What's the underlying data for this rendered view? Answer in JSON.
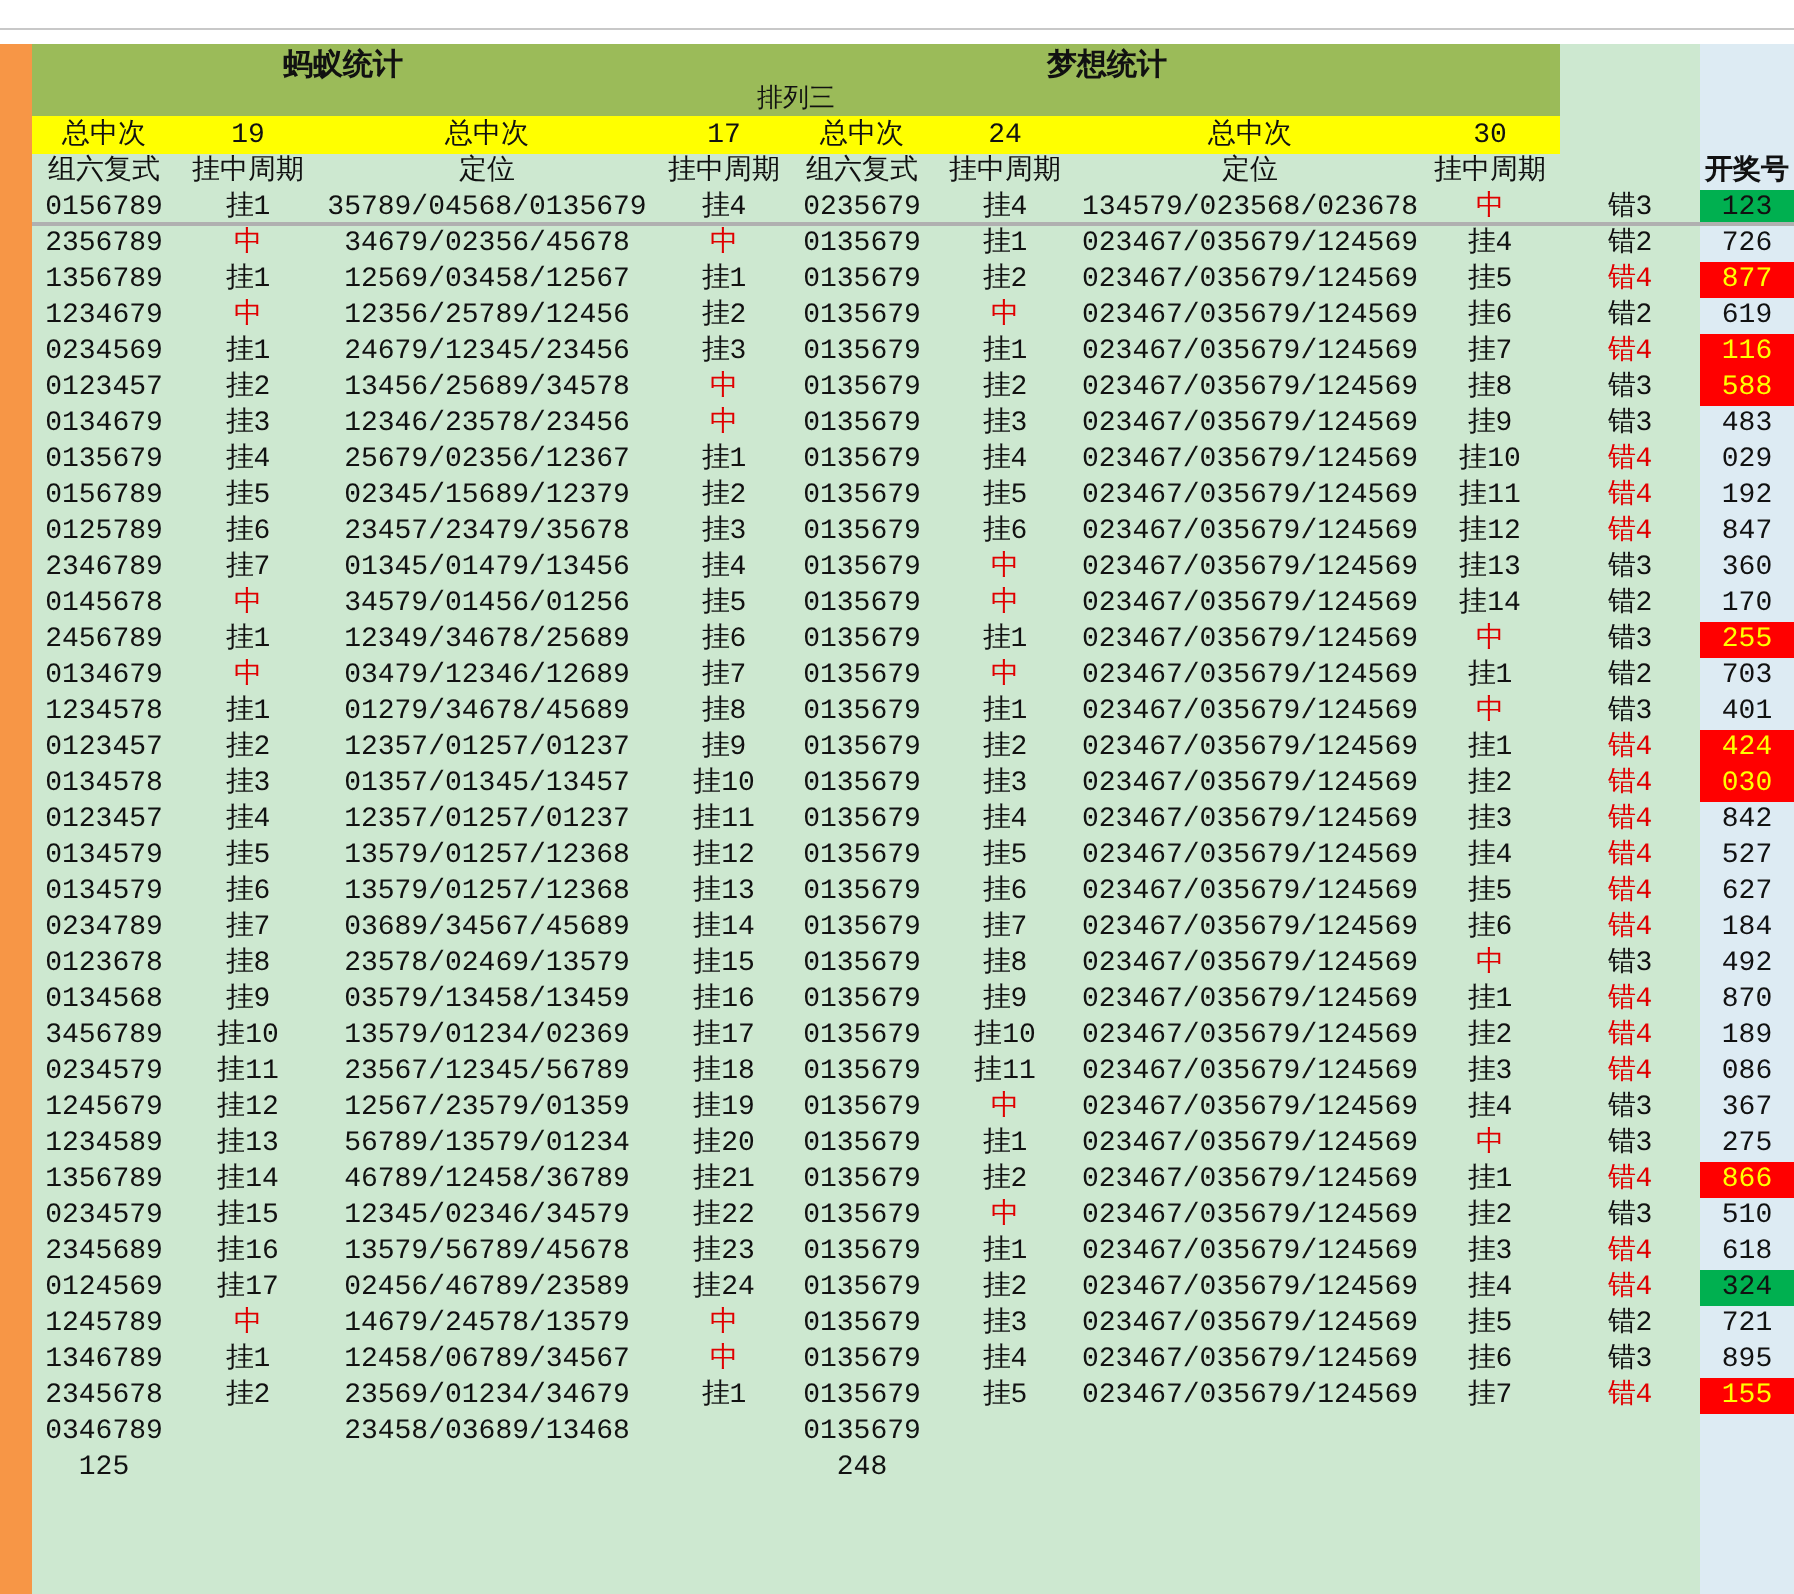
{
  "title": "排列三",
  "sections": [
    {
      "title": "蚂蚁统计"
    },
    {
      "title": "梦想统计"
    }
  ],
  "summary": [
    {
      "label": "总中次",
      "value": "19"
    },
    {
      "label": "总中次",
      "value": "17"
    },
    {
      "label": "总中次",
      "value": "24"
    },
    {
      "label": "总中次",
      "value": "30"
    }
  ],
  "columns": [
    "组六复式",
    "挂中周期",
    "定位",
    "挂中周期",
    "组六复式",
    "挂中周期",
    "定位",
    "挂中周期"
  ],
  "draw_column": "开奖号",
  "rows": [
    {
      "combo1": "0156789",
      "cycle1": "挂1",
      "cycle1_hit": false,
      "pos1": "35789/04568/0135679",
      "pos_cycle1": "挂4",
      "pos_cycle1_hit": false,
      "combo2": "0235679",
      "cycle2": "挂4",
      "cycle2_hit": false,
      "pos2": "134579/023568/023678",
      "pos_cycle2": "中",
      "pos_cycle2_hit": true,
      "miss": "错3",
      "miss_high": false,
      "draw": {
        "number": "123",
        "color": "#00b050"
      }
    },
    {
      "combo1": "2356789",
      "cycle1": "中",
      "cycle1_hit": true,
      "pos1": "34679/02356/45678",
      "pos_cycle1": "中",
      "pos_cycle1_hit": true,
      "combo2": "0135679",
      "cycle2": "挂1",
      "cycle2_hit": false,
      "pos2": "023467/035679/124569",
      "pos_cycle2": "挂4",
      "pos_cycle2_hit": false,
      "miss": "错2",
      "miss_high": false,
      "draw": {
        "number": "726"
      }
    },
    {
      "combo1": "1356789",
      "cycle1": "挂1",
      "cycle1_hit": false,
      "pos1": "12569/03458/12567",
      "pos_cycle1": "挂1",
      "pos_cycle1_hit": false,
      "combo2": "0135679",
      "cycle2": "挂2",
      "cycle2_hit": false,
      "pos2": "023467/035679/124569",
      "pos_cycle2": "挂5",
      "pos_cycle2_hit": false,
      "miss": "错4",
      "miss_high": true,
      "draw": {
        "number": "877",
        "color": "#ff0000"
      }
    },
    {
      "combo1": "1234679",
      "cycle1": "中",
      "cycle1_hit": true,
      "pos1": "12356/25789/12456",
      "pos_cycle1": "挂2",
      "pos_cycle1_hit": false,
      "combo2": "0135679",
      "cycle2": "中",
      "cycle2_hit": true,
      "pos2": "023467/035679/124569",
      "pos_cycle2": "挂6",
      "pos_cycle2_hit": false,
      "miss": "错2",
      "miss_high": false,
      "draw": {
        "number": "619"
      }
    },
    {
      "combo1": "0234569",
      "cycle1": "挂1",
      "cycle1_hit": false,
      "pos1": "24679/12345/23456",
      "pos_cycle1": "挂3",
      "pos_cycle1_hit": false,
      "combo2": "0135679",
      "cycle2": "挂1",
      "cycle2_hit": false,
      "pos2": "023467/035679/124569",
      "pos_cycle2": "挂7",
      "pos_cycle2_hit": false,
      "miss": "错4",
      "miss_high": true,
      "draw": {
        "number": "116",
        "color": "#ff0000"
      }
    },
    {
      "combo1": "0123457",
      "cycle1": "挂2",
      "cycle1_hit": false,
      "pos1": "13456/25689/34578",
      "pos_cycle1": "中",
      "pos_cycle1_hit": true,
      "combo2": "0135679",
      "cycle2": "挂2",
      "cycle2_hit": false,
      "pos2": "023467/035679/124569",
      "pos_cycle2": "挂8",
      "pos_cycle2_hit": false,
      "miss": "错3",
      "miss_high": false,
      "draw": {
        "number": "588",
        "color": "#ff0000"
      }
    },
    {
      "combo1": "0134679",
      "cycle1": "挂3",
      "cycle1_hit": false,
      "pos1": "12346/23578/23456",
      "pos_cycle1": "中",
      "pos_cycle1_hit": true,
      "combo2": "0135679",
      "cycle2": "挂3",
      "cycle2_hit": false,
      "pos2": "023467/035679/124569",
      "pos_cycle2": "挂9",
      "pos_cycle2_hit": false,
      "miss": "错3",
      "miss_high": false,
      "draw": {
        "number": "483"
      }
    },
    {
      "combo1": "0135679",
      "cycle1": "挂4",
      "cycle1_hit": false,
      "pos1": "25679/02356/12367",
      "pos_cycle1": "挂1",
      "pos_cycle1_hit": false,
      "combo2": "0135679",
      "cycle2": "挂4",
      "cycle2_hit": false,
      "pos2": "023467/035679/124569",
      "pos_cycle2": "挂10",
      "pos_cycle2_hit": false,
      "miss": "错4",
      "miss_high": true,
      "draw": {
        "number": "029"
      }
    },
    {
      "combo1": "0156789",
      "cycle1": "挂5",
      "cycle1_hit": false,
      "pos1": "02345/15689/12379",
      "pos_cycle1": "挂2",
      "pos_cycle1_hit": false,
      "combo2": "0135679",
      "cycle2": "挂5",
      "cycle2_hit": false,
      "pos2": "023467/035679/124569",
      "pos_cycle2": "挂11",
      "pos_cycle2_hit": false,
      "miss": "错4",
      "miss_high": true,
      "draw": {
        "number": "192"
      }
    },
    {
      "combo1": "0125789",
      "cycle1": "挂6",
      "cycle1_hit": false,
      "pos1": "23457/23479/35678",
      "pos_cycle1": "挂3",
      "pos_cycle1_hit": false,
      "combo2": "0135679",
      "cycle2": "挂6",
      "cycle2_hit": false,
      "pos2": "023467/035679/124569",
      "pos_cycle2": "挂12",
      "pos_cycle2_hit": false,
      "miss": "错4",
      "miss_high": true,
      "draw": {
        "number": "847"
      }
    },
    {
      "combo1": "2346789",
      "cycle1": "挂7",
      "cycle1_hit": false,
      "pos1": "01345/01479/13456",
      "pos_cycle1": "挂4",
      "pos_cycle1_hit": false,
      "combo2": "0135679",
      "cycle2": "中",
      "cycle2_hit": true,
      "pos2": "023467/035679/124569",
      "pos_cycle2": "挂13",
      "pos_cycle2_hit": false,
      "miss": "错3",
      "miss_high": false,
      "draw": {
        "number": "360"
      }
    },
    {
      "combo1": "0145678",
      "cycle1": "中",
      "cycle1_hit": true,
      "pos1": "34579/01456/01256",
      "pos_cycle1": "挂5",
      "pos_cycle1_hit": false,
      "combo2": "0135679",
      "cycle2": "中",
      "cycle2_hit": true,
      "pos2": "023467/035679/124569",
      "pos_cycle2": "挂14",
      "pos_cycle2_hit": false,
      "miss": "错2",
      "miss_high": false,
      "draw": {
        "number": "170"
      }
    },
    {
      "combo1": "2456789",
      "cycle1": "挂1",
      "cycle1_hit": false,
      "pos1": "12349/34678/25689",
      "pos_cycle1": "挂6",
      "pos_cycle1_hit": false,
      "combo2": "0135679",
      "cycle2": "挂1",
      "cycle2_hit": false,
      "pos2": "023467/035679/124569",
      "pos_cycle2": "中",
      "pos_cycle2_hit": true,
      "miss": "错3",
      "miss_high": false,
      "draw": {
        "number": "255",
        "color": "#ff0000"
      }
    },
    {
      "combo1": "0134679",
      "cycle1": "中",
      "cycle1_hit": true,
      "pos1": "03479/12346/12689",
      "pos_cycle1": "挂7",
      "pos_cycle1_hit": false,
      "combo2": "0135679",
      "cycle2": "中",
      "cycle2_hit": true,
      "pos2": "023467/035679/124569",
      "pos_cycle2": "挂1",
      "pos_cycle2_hit": false,
      "miss": "错2",
      "miss_high": false,
      "draw": {
        "number": "703"
      }
    },
    {
      "combo1": "1234578",
      "cycle1": "挂1",
      "cycle1_hit": false,
      "pos1": "01279/34678/45689",
      "pos_cycle1": "挂8",
      "pos_cycle1_hit": false,
      "combo2": "0135679",
      "cycle2": "挂1",
      "cycle2_hit": false,
      "pos2": "023467/035679/124569",
      "pos_cycle2": "中",
      "pos_cycle2_hit": true,
      "miss": "错3",
      "miss_high": false,
      "draw": {
        "number": "401"
      }
    },
    {
      "combo1": "0123457",
      "cycle1": "挂2",
      "cycle1_hit": false,
      "pos1": "12357/01257/01237",
      "pos_cycle1": "挂9",
      "pos_cycle1_hit": false,
      "combo2": "0135679",
      "cycle2": "挂2",
      "cycle2_hit": false,
      "pos2": "023467/035679/124569",
      "pos_cycle2": "挂1",
      "pos_cycle2_hit": false,
      "miss": "错4",
      "miss_high": true,
      "draw": {
        "number": "424",
        "color": "#ff0000"
      }
    },
    {
      "combo1": "0134578",
      "cycle1": "挂3",
      "cycle1_hit": false,
      "pos1": "01357/01345/13457",
      "pos_cycle1": "挂10",
      "pos_cycle1_hit": false,
      "combo2": "0135679",
      "cycle2": "挂3",
      "cycle2_hit": false,
      "pos2": "023467/035679/124569",
      "pos_cycle2": "挂2",
      "pos_cycle2_hit": false,
      "miss": "错4",
      "miss_high": true,
      "draw": {
        "number": "030",
        "color": "#ff0000"
      }
    },
    {
      "combo1": "0123457",
      "cycle1": "挂4",
      "cycle1_hit": false,
      "pos1": "12357/01257/01237",
      "pos_cycle1": "挂11",
      "pos_cycle1_hit": false,
      "combo2": "0135679",
      "cycle2": "挂4",
      "cycle2_hit": false,
      "pos2": "023467/035679/124569",
      "pos_cycle2": "挂3",
      "pos_cycle2_hit": false,
      "miss": "错4",
      "miss_high": true,
      "draw": {
        "number": "842"
      }
    },
    {
      "combo1": "0134579",
      "cycle1": "挂5",
      "cycle1_hit": false,
      "pos1": "13579/01257/12368",
      "pos_cycle1": "挂12",
      "pos_cycle1_hit": false,
      "combo2": "0135679",
      "cycle2": "挂5",
      "cycle2_hit": false,
      "pos2": "023467/035679/124569",
      "pos_cycle2": "挂4",
      "pos_cycle2_hit": false,
      "miss": "错4",
      "miss_high": true,
      "draw": {
        "number": "527"
      }
    },
    {
      "combo1": "0134579",
      "cycle1": "挂6",
      "cycle1_hit": false,
      "pos1": "13579/01257/12368",
      "pos_cycle1": "挂13",
      "pos_cycle1_hit": false,
      "combo2": "0135679",
      "cycle2": "挂6",
      "cycle2_hit": false,
      "pos2": "023467/035679/124569",
      "pos_cycle2": "挂5",
      "pos_cycle2_hit": false,
      "miss": "错4",
      "miss_high": true,
      "draw": {
        "number": "627"
      }
    },
    {
      "combo1": "0234789",
      "cycle1": "挂7",
      "cycle1_hit": false,
      "pos1": "03689/34567/45689",
      "pos_cycle1": "挂14",
      "pos_cycle1_hit": false,
      "combo2": "0135679",
      "cycle2": "挂7",
      "cycle2_hit": false,
      "pos2": "023467/035679/124569",
      "pos_cycle2": "挂6",
      "pos_cycle2_hit": false,
      "miss": "错4",
      "miss_high": true,
      "draw": {
        "number": "184"
      }
    },
    {
      "combo1": "0123678",
      "cycle1": "挂8",
      "cycle1_hit": false,
      "pos1": "23578/02469/13579",
      "pos_cycle1": "挂15",
      "pos_cycle1_hit": false,
      "combo2": "0135679",
      "cycle2": "挂8",
      "cycle2_hit": false,
      "pos2": "023467/035679/124569",
      "pos_cycle2": "中",
      "pos_cycle2_hit": true,
      "miss": "错3",
      "miss_high": false,
      "draw": {
        "number": "492"
      }
    },
    {
      "combo1": "0134568",
      "cycle1": "挂9",
      "cycle1_hit": false,
      "pos1": "03579/13458/13459",
      "pos_cycle1": "挂16",
      "pos_cycle1_hit": false,
      "combo2": "0135679",
      "cycle2": "挂9",
      "cycle2_hit": false,
      "pos2": "023467/035679/124569",
      "pos_cycle2": "挂1",
      "pos_cycle2_hit": false,
      "miss": "错4",
      "miss_high": true,
      "draw": {
        "number": "870"
      }
    },
    {
      "combo1": "3456789",
      "cycle1": "挂10",
      "cycle1_hit": false,
      "pos1": "13579/01234/02369",
      "pos_cycle1": "挂17",
      "pos_cycle1_hit": false,
      "combo2": "0135679",
      "cycle2": "挂10",
      "cycle2_hit": false,
      "pos2": "023467/035679/124569",
      "pos_cycle2": "挂2",
      "pos_cycle2_hit": false,
      "miss": "错4",
      "miss_high": true,
      "draw": {
        "number": "189"
      }
    },
    {
      "combo1": "0234579",
      "cycle1": "挂11",
      "cycle1_hit": false,
      "pos1": "23567/12345/56789",
      "pos_cycle1": "挂18",
      "pos_cycle1_hit": false,
      "combo2": "0135679",
      "cycle2": "挂11",
      "cycle2_hit": false,
      "pos2": "023467/035679/124569",
      "pos_cycle2": "挂3",
      "pos_cycle2_hit": false,
      "miss": "错4",
      "miss_high": true,
      "draw": {
        "number": "086"
      }
    },
    {
      "combo1": "1245679",
      "cycle1": "挂12",
      "cycle1_hit": false,
      "pos1": "12567/23579/01359",
      "pos_cycle1": "挂19",
      "pos_cycle1_hit": false,
      "combo2": "0135679",
      "cycle2": "中",
      "cycle2_hit": true,
      "pos2": "023467/035679/124569",
      "pos_cycle2": "挂4",
      "pos_cycle2_hit": false,
      "miss": "错3",
      "miss_high": false,
      "draw": {
        "number": "367"
      }
    },
    {
      "combo1": "1234589",
      "cycle1": "挂13",
      "cycle1_hit": false,
      "pos1": "56789/13579/01234",
      "pos_cycle1": "挂20",
      "pos_cycle1_hit": false,
      "combo2": "0135679",
      "cycle2": "挂1",
      "cycle2_hit": false,
      "pos2": "023467/035679/124569",
      "pos_cycle2": "中",
      "pos_cycle2_hit": true,
      "miss": "错3",
      "miss_high": false,
      "draw": {
        "number": "275"
      }
    },
    {
      "combo1": "1356789",
      "cycle1": "挂14",
      "cycle1_hit": false,
      "pos1": "46789/12458/36789",
      "pos_cycle1": "挂21",
      "pos_cycle1_hit": false,
      "combo2": "0135679",
      "cycle2": "挂2",
      "cycle2_hit": false,
      "pos2": "023467/035679/124569",
      "pos_cycle2": "挂1",
      "pos_cycle2_hit": false,
      "miss": "错4",
      "miss_high": true,
      "draw": {
        "number": "866",
        "color": "#ff0000"
      }
    },
    {
      "combo1": "0234579",
      "cycle1": "挂15",
      "cycle1_hit": false,
      "pos1": "12345/02346/34579",
      "pos_cycle1": "挂22",
      "pos_cycle1_hit": false,
      "combo2": "0135679",
      "cycle2": "中",
      "cycle2_hit": true,
      "pos2": "023467/035679/124569",
      "pos_cycle2": "挂2",
      "pos_cycle2_hit": false,
      "miss": "错3",
      "miss_high": false,
      "draw": {
        "number": "510"
      }
    },
    {
      "combo1": "2345689",
      "cycle1": "挂16",
      "cycle1_hit": false,
      "pos1": "13579/56789/45678",
      "pos_cycle1": "挂23",
      "pos_cycle1_hit": false,
      "combo2": "0135679",
      "cycle2": "挂1",
      "cycle2_hit": false,
      "pos2": "023467/035679/124569",
      "pos_cycle2": "挂3",
      "pos_cycle2_hit": false,
      "miss": "错4",
      "miss_high": true,
      "draw": {
        "number": "618"
      }
    },
    {
      "combo1": "0124569",
      "cycle1": "挂17",
      "cycle1_hit": false,
      "pos1": "02456/46789/23589",
      "pos_cycle1": "挂24",
      "pos_cycle1_hit": false,
      "combo2": "0135679",
      "cycle2": "挂2",
      "cycle2_hit": false,
      "pos2": "023467/035679/124569",
      "pos_cycle2": "挂4",
      "pos_cycle2_hit": false,
      "miss": "错4",
      "miss_high": true,
      "draw": {
        "number": "324",
        "color": "#00b050"
      }
    },
    {
      "combo1": "1245789",
      "cycle1": "中",
      "cycle1_hit": true,
      "pos1": "14679/24578/13579",
      "pos_cycle1": "中",
      "pos_cycle1_hit": true,
      "combo2": "0135679",
      "cycle2": "挂3",
      "cycle2_hit": false,
      "pos2": "023467/035679/124569",
      "pos_cycle2": "挂5",
      "pos_cycle2_hit": false,
      "miss": "错2",
      "miss_high": false,
      "draw": {
        "number": "721"
      }
    },
    {
      "combo1": "1346789",
      "cycle1": "挂1",
      "cycle1_hit": false,
      "pos1": "12458/06789/34567",
      "pos_cycle1": "中",
      "pos_cycle1_hit": true,
      "combo2": "0135679",
      "cycle2": "挂4",
      "cycle2_hit": false,
      "pos2": "023467/035679/124569",
      "pos_cycle2": "挂6",
      "pos_cycle2_hit": false,
      "miss": "错3",
      "miss_high": false,
      "draw": {
        "number": "895"
      }
    },
    {
      "combo1": "2345678",
      "cycle1": "挂2",
      "cycle1_hit": false,
      "pos1": "23569/01234/34679",
      "pos_cycle1": "挂1",
      "pos_cycle1_hit": false,
      "combo2": "0135679",
      "cycle2": "挂5",
      "cycle2_hit": false,
      "pos2": "023467/035679/124569",
      "pos_cycle2": "挂7",
      "pos_cycle2_hit": false,
      "miss": "错4",
      "miss_high": true,
      "draw": {
        "number": "155",
        "color": "#ff0000"
      }
    },
    {
      "combo1": "0346789",
      "pos1": "23458/03689/13468",
      "combo2": "0135679"
    }
  ],
  "totals": [
    "125",
    "248"
  ]
}
